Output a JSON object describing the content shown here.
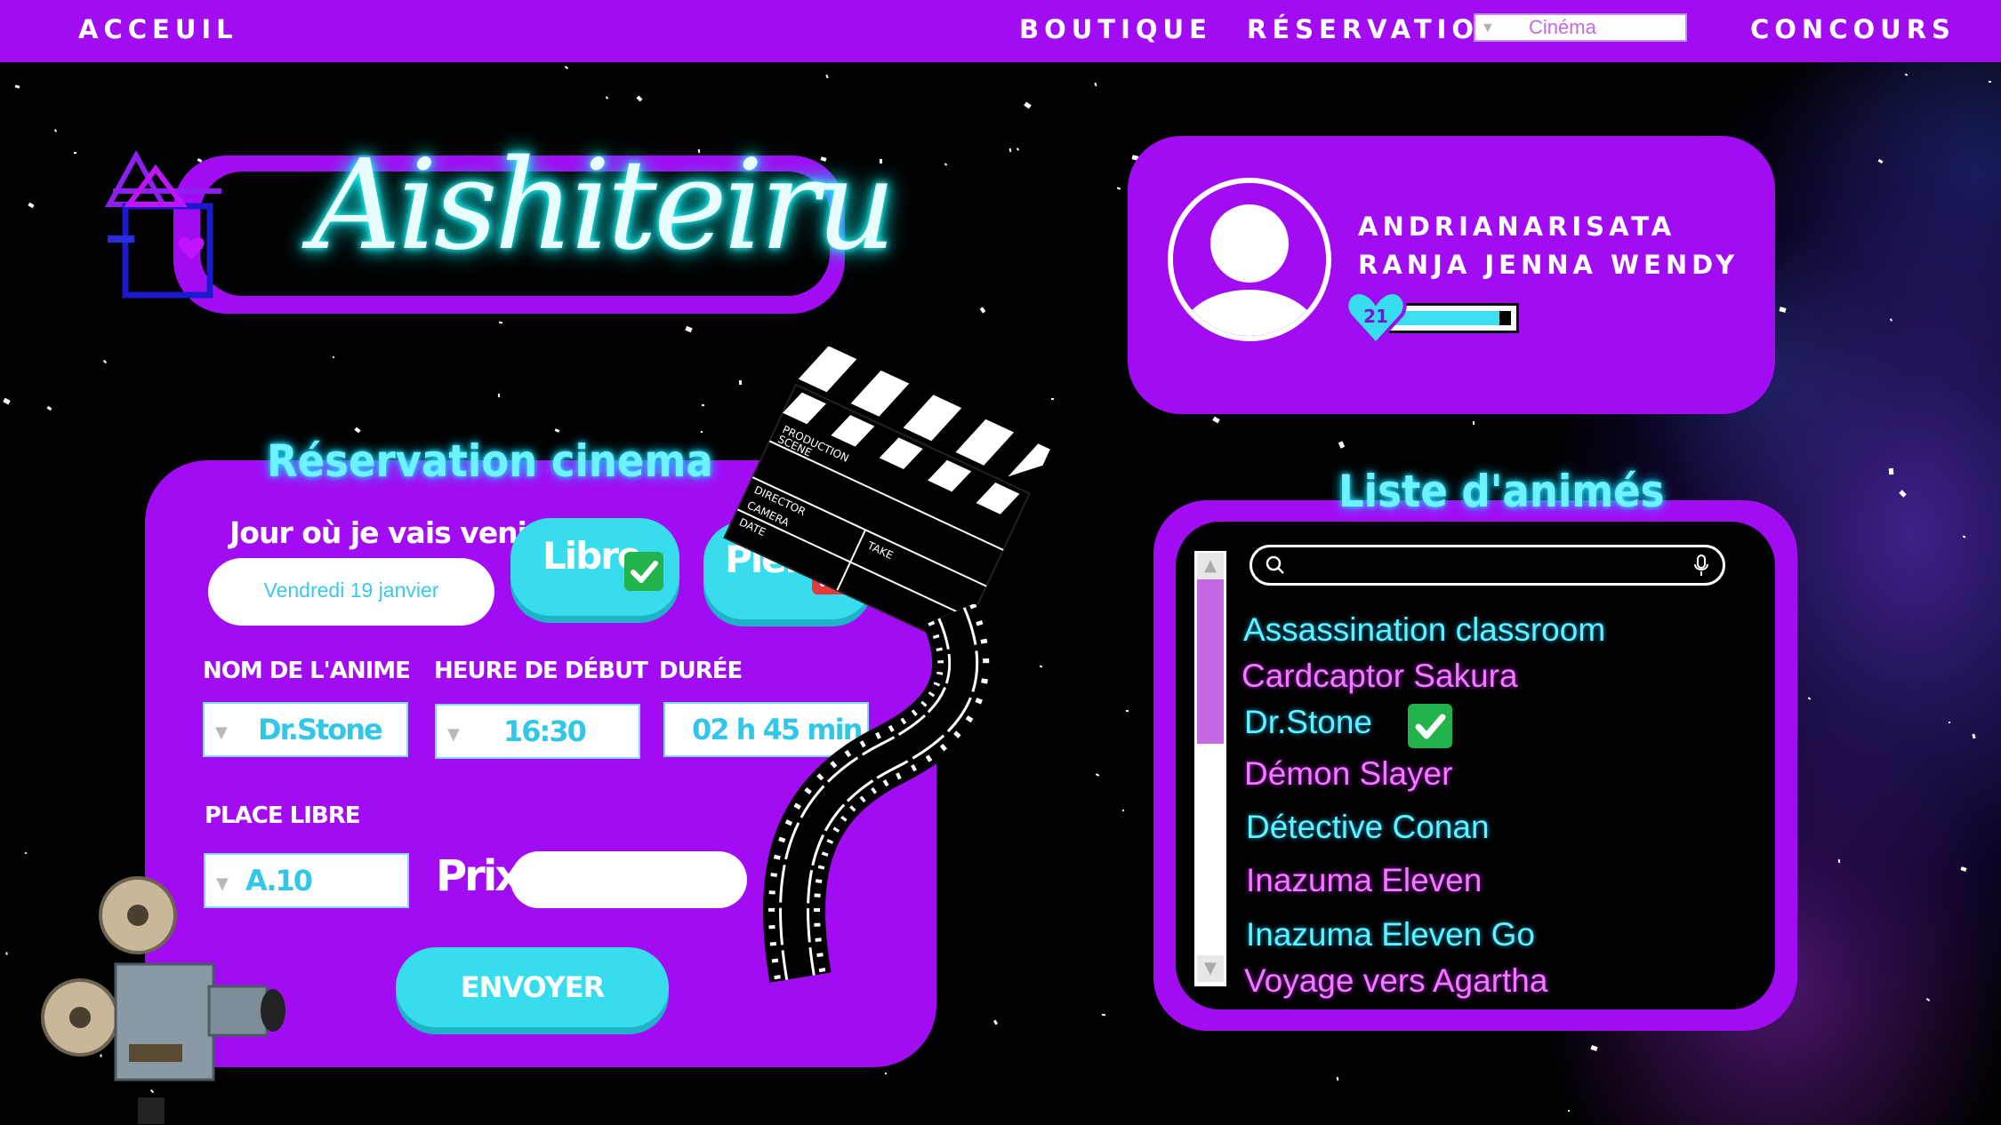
{
  "nav": {
    "home": "ACCEUIL",
    "shop": "BOUTIQUE",
    "reservation": "RÉSERVATION",
    "reservation_select": "Cinéma",
    "contest": "CONCOURS"
  },
  "logo": {
    "text": "Aishiteiru"
  },
  "profile": {
    "name_line1": "ANDRIANARISATA",
    "name_line2": "RANJA JENNA WENDY",
    "level": "21",
    "progress": 0.9
  },
  "reservation": {
    "title": "Réservation cinema",
    "day_label": "Jour où je vais venir",
    "day_value": "Vendredi 19 janvier",
    "libre_label": "Libre",
    "plein_label": "Plein",
    "anime_label": "NOM DE L'ANIME",
    "anime_value": "Dr.Stone",
    "start_label": "HEURE DE DÉBUT",
    "start_value": "16:30",
    "duration_label": "DURÉE",
    "duration_value": "02 h 45 min",
    "seat_label": "PLACE LIBRE",
    "seat_value": "A.10",
    "price_label": "Prix",
    "price_value": "",
    "submit_label": "ENVOYER"
  },
  "anime_list": {
    "title": "Liste d'animés",
    "search_placeholder": "",
    "items": [
      "Assassination classroom",
      "Cardcaptor Sakura",
      "Dr.Stone",
      "Démon Slayer",
      "Détective Conan",
      "Inazuma Eleven",
      "Inazuma Eleven Go",
      "Voyage vers Agartha"
    ],
    "checked": "Dr.Stone"
  },
  "clapper": {
    "production": "PRODUCTION",
    "scene": "SCENE",
    "take": "TAKE",
    "director": "DIRECTOR",
    "camera": "CAMERA",
    "date": "DATE"
  },
  "colors": {
    "purple": "#a20cf3",
    "cyan": "#37dcef",
    "neon_cyan": "#6ff2ff",
    "neon_pink": "#ef7cff"
  }
}
